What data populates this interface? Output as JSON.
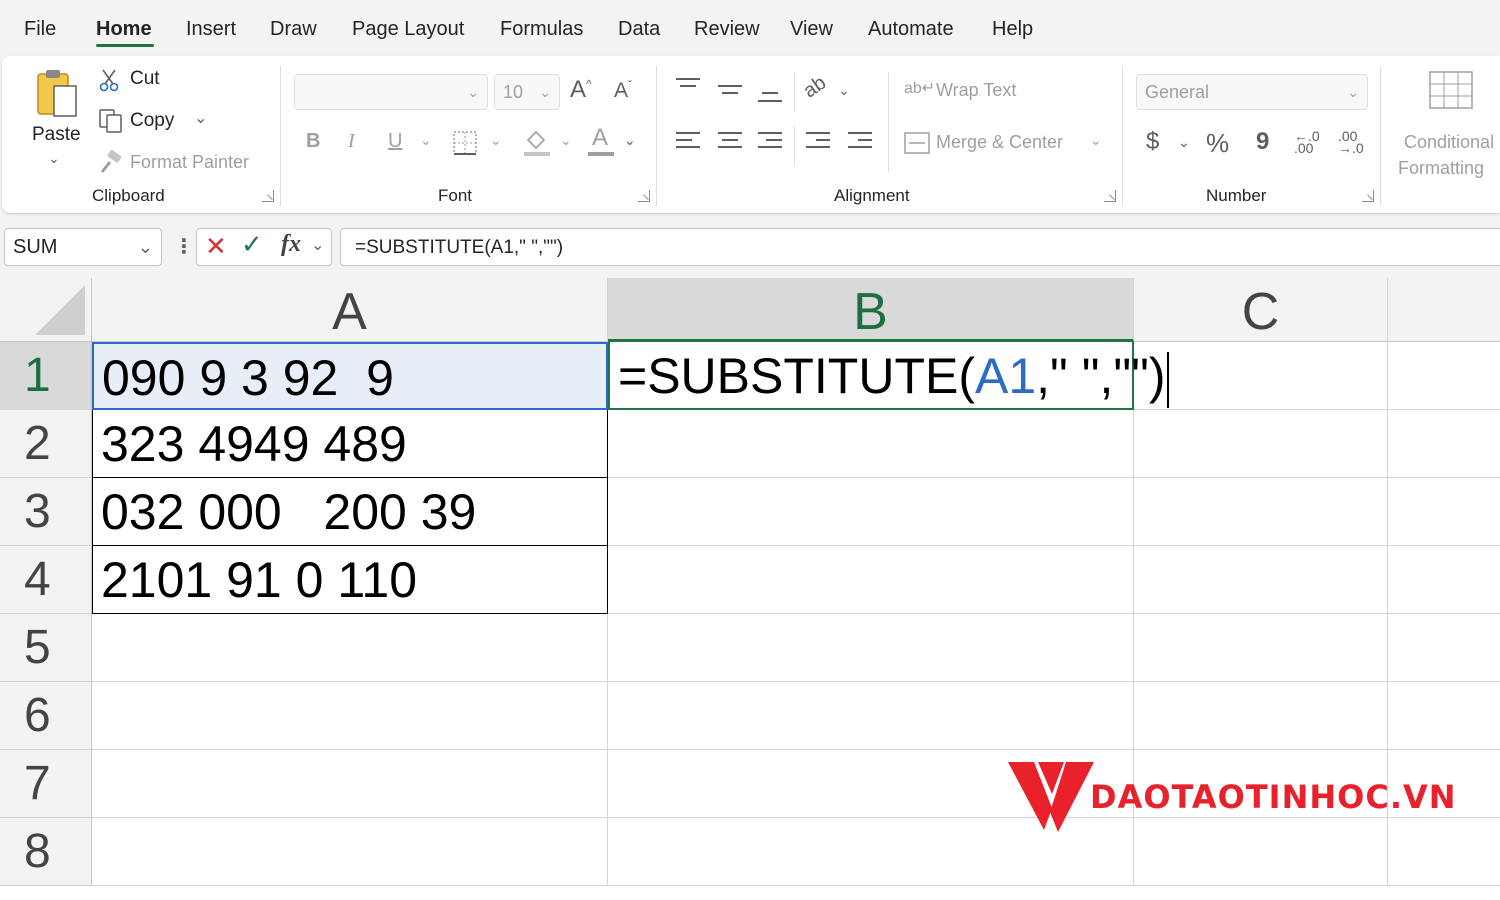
{
  "menu": {
    "tabs": [
      "File",
      "Home",
      "Insert",
      "Draw",
      "Page Layout",
      "Formulas",
      "Data",
      "Review",
      "View",
      "Automate",
      "Help"
    ],
    "active": "Home"
  },
  "ribbon": {
    "clipboard": {
      "paste": "Paste",
      "cut": "Cut",
      "copy": "Copy",
      "format_painter": "Format Painter",
      "label": "Clipboard"
    },
    "font": {
      "name": "",
      "size": "10",
      "bold": "B",
      "italic": "I",
      "underline": "U",
      "label": "Font"
    },
    "alignment": {
      "wrap_text": "Wrap Text",
      "merge_center": "Merge & Center",
      "label": "Alignment"
    },
    "number": {
      "format": "General",
      "currency": "$",
      "percent": "%",
      "comma": "9",
      "label": "Number"
    },
    "styles": {
      "conditional_line1": "Conditional",
      "conditional_line2": "Formatting"
    }
  },
  "formula_bar": {
    "name_box": "SUM",
    "fx": "fx",
    "formula": "=SUBSTITUTE(A1,\" \",\"\")"
  },
  "sheet": {
    "columns": [
      "A",
      "B",
      "C"
    ],
    "rows": [
      "1",
      "2",
      "3",
      "4",
      "5",
      "6",
      "7",
      "8"
    ],
    "col_a": [
      "090 9 3 92  9",
      "323 4949 489",
      "032 000   200 39",
      "2101 91 0 110"
    ],
    "edit_cell": {
      "prefix": "=SUBSTITUTE(",
      "ref": "A1",
      "suffix": ",\" \",\"\")"
    },
    "ref_color": "#2e6bc6"
  },
  "watermark": {
    "text": "DAOTAOTINHOC.VN",
    "color": "#e8212a"
  },
  "colors": {
    "accent": "#217346",
    "cancel": "#d13438"
  }
}
